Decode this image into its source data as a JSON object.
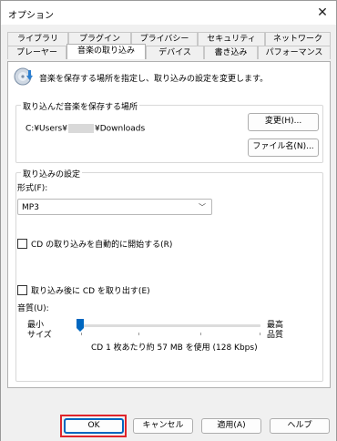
{
  "window": {
    "title": "オプション",
    "close_glyph": "✕"
  },
  "tabs": {
    "row1": [
      "ライブラリ",
      "プラグイン",
      "プライバシー",
      "セキュリティ",
      "ネットワーク"
    ],
    "row2": [
      "プレーヤー",
      "音楽の取り込み",
      "デバイス",
      "書き込み",
      "パフォーマンス"
    ],
    "active": "音楽の取り込み"
  },
  "intro": {
    "icon": "rip-music-icon",
    "text": "音楽を保存する場所を指定し、取り込みの設定を変更します。"
  },
  "save_location": {
    "legend": "取り込んだ音楽を保存する場所",
    "path_prefix": "C:¥Users¥",
    "path_suffix": "¥Downloads",
    "change_button": "変更(H)...",
    "filename_button": "ファイル名(N)..."
  },
  "rip_settings": {
    "legend": "取り込みの設定",
    "format_label": "形式(F):",
    "format_value": "MP3",
    "auto_rip_label": "CD の取り込みを自動的に開始する(R)",
    "eject_label": "取り込み後に CD を取り出す(E)",
    "quality_label": "音質(U):",
    "min_label_1": "最小",
    "min_label_2": "サイズ",
    "max_label_1": "最高",
    "max_label_2": "品質",
    "quality_text": "CD 1 枚あたり約 57 MB を使用 (128 Kbps)",
    "quality_level": 0
  },
  "buttons": {
    "ok": "OK",
    "cancel": "キャンセル",
    "apply": "適用(A)",
    "help": "ヘルプ"
  },
  "colors": {
    "highlight": "#e0242b",
    "accent": "#0067c0"
  }
}
